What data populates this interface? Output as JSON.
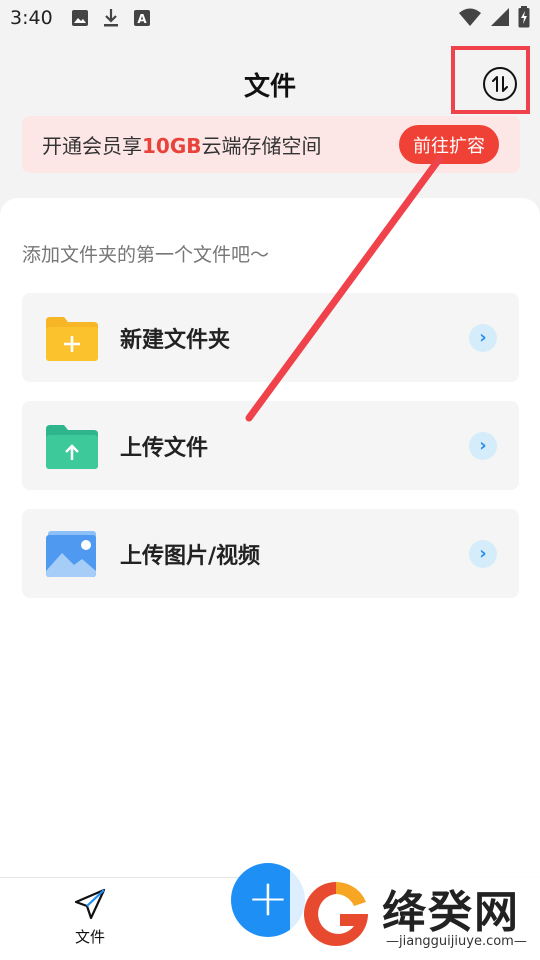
{
  "status_bar": {
    "time": "3:40",
    "left_icons": [
      "image-icon",
      "download-icon",
      "text-a-icon"
    ],
    "right_icons": [
      "wifi-icon",
      "signal-icon",
      "battery-charging-icon"
    ]
  },
  "header": {
    "title": "文件",
    "sort_icon": "sort-arrows-icon"
  },
  "banner": {
    "text_before": "开通会员享",
    "text_highlight": "10GB",
    "text_after": "云端存储空间",
    "button_label": "前往扩容"
  },
  "main": {
    "hint": "添加文件夹的第一个文件吧～",
    "actions": [
      {
        "label": "新建文件夹",
        "icon": "new-folder-icon"
      },
      {
        "label": "上传文件",
        "icon": "upload-file-icon"
      },
      {
        "label": "上传图片/视频",
        "icon": "upload-image-icon"
      }
    ]
  },
  "bottom_nav": {
    "files_label": "文件",
    "files_icon": "paper-plane-icon"
  },
  "watermark": {
    "brand": "绛癸网",
    "url": "—jiangguijiuye.com—"
  },
  "colors": {
    "accent": "#1e8ff5",
    "banner_bg": "#fde6e6",
    "banner_button": "#ef4136",
    "highlight": "#f0424a"
  }
}
